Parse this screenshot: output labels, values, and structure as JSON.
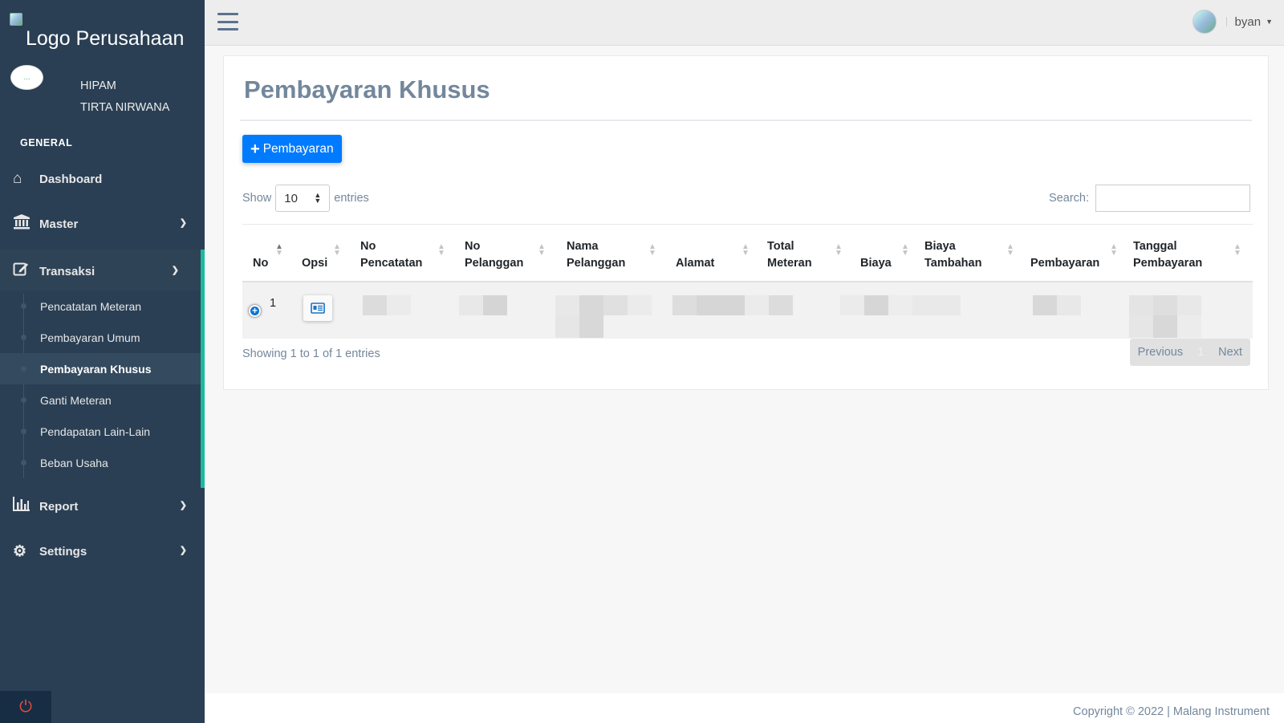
{
  "sidebar": {
    "logo_alt": "Logo Perusahaan",
    "profile": {
      "name_line1": "HIPAM",
      "name_line2": "TIRTA NIRWANA",
      "avatar_alt": "..."
    },
    "section_title": "GENERAL",
    "items": [
      {
        "label": "Dashboard",
        "icon": "home-icon"
      },
      {
        "label": "Master",
        "icon": "bank-icon"
      },
      {
        "label": "Transaksi",
        "icon": "edit-icon"
      },
      {
        "label": "Report",
        "icon": "bar-chart-icon"
      },
      {
        "label": "Settings",
        "icon": "gears-icon"
      }
    ],
    "submenu": [
      {
        "label": "Pencatatan Meteran"
      },
      {
        "label": "Pembayaran Umum"
      },
      {
        "label": "Pembayaran Khusus"
      },
      {
        "label": "Ganti Meteran"
      },
      {
        "label": "Pendapatan Lain-Lain"
      },
      {
        "label": "Beban Usaha"
      }
    ],
    "power_icon": "power-icon"
  },
  "topbar": {
    "user_name": "byan",
    "menu_icon": "hamburger-icon"
  },
  "main": {
    "title": "Pembayaran Khusus",
    "add_button": "Pembayaran",
    "show_label": "Show",
    "entries_value": "10",
    "entries_label": "entries",
    "search_label": "Search:",
    "columns": [
      {
        "line1": "",
        "line2": "No"
      },
      {
        "line1": "",
        "line2": "Opsi"
      },
      {
        "line1": "No",
        "line2": "Pencatatan"
      },
      {
        "line1": "No",
        "line2": "Pelanggan"
      },
      {
        "line1": "Nama",
        "line2": "Pelanggan"
      },
      {
        "line1": "",
        "line2": "Alamat"
      },
      {
        "line1": "Total",
        "line2": "Meteran"
      },
      {
        "line1": "",
        "line2": "Biaya"
      },
      {
        "line1": "Biaya",
        "line2": "Tambahan"
      },
      {
        "line1": "",
        "line2": "Pembayaran"
      },
      {
        "line1": "Tanggal",
        "line2": "Pembayaran"
      }
    ],
    "rows": [
      {
        "no": "1"
      }
    ],
    "info": "Showing 1 to 1 of 1 entries",
    "pagination": {
      "previous": "Previous",
      "page": "1",
      "next": "Next"
    }
  },
  "footer": {
    "text": "Copyright © 2022 | Malang Instrument"
  },
  "colors": {
    "sidebar": "#2a3f54",
    "accent": "#1abb9c",
    "primary": "#007bff"
  }
}
